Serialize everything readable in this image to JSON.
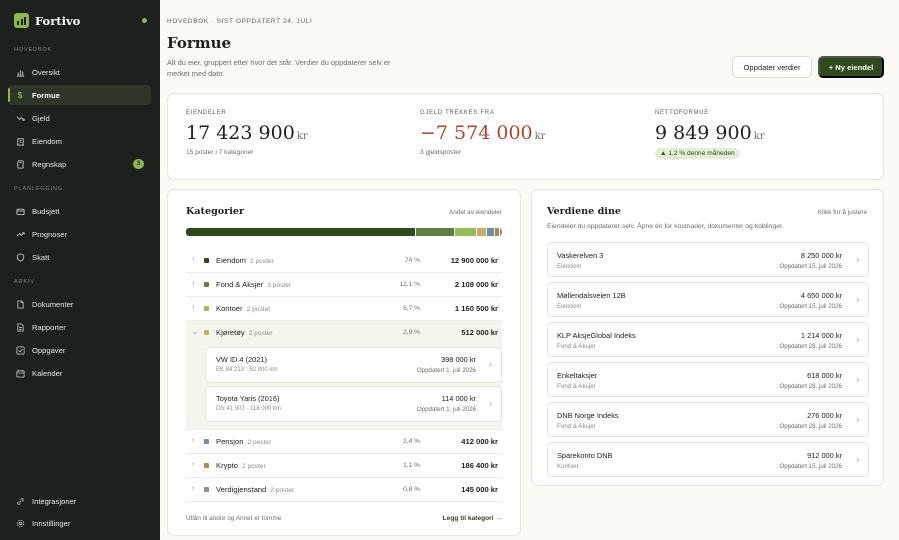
{
  "app": {
    "name": "Fortivo",
    "status_color": "#8ab94a",
    "accent": "#2f4a1b",
    "negative": "#b2432c"
  },
  "sidebar": {
    "sections": [
      {
        "label": "HOVEDBOK",
        "items": [
          {
            "label": "Oversikt",
            "icon": "bar-chart-icon"
          },
          {
            "label": "Formue",
            "icon": "dollar-icon",
            "active": true
          },
          {
            "label": "Gjeld",
            "icon": "trend-down-icon"
          },
          {
            "label": "Eiendom",
            "icon": "building-icon"
          },
          {
            "label": "Regnskap",
            "icon": "calculator-icon",
            "badge": "3"
          }
        ]
      },
      {
        "label": "PLANLEGGING",
        "items": [
          {
            "label": "Budsjett",
            "icon": "wallet-icon"
          },
          {
            "label": "Prognoser",
            "icon": "trend-up-icon"
          },
          {
            "label": "Skatt",
            "icon": "shield-icon"
          }
        ]
      },
      {
        "label": "ARKIV",
        "items": [
          {
            "label": "Dokumenter",
            "icon": "document-icon"
          },
          {
            "label": "Rapporter",
            "icon": "report-icon"
          },
          {
            "label": "Oppgaver",
            "icon": "checkbox-icon"
          },
          {
            "label": "Kalender",
            "icon": "calendar-icon"
          }
        ]
      }
    ],
    "footer": [
      {
        "label": "Integrasjoner",
        "icon": "link-icon"
      },
      {
        "label": "Innstillinger",
        "icon": "gear-icon"
      }
    ]
  },
  "header": {
    "eyebrow": "HOVEDBOK · SIST OPPDATERT 24. JULI",
    "title": "Formue",
    "subtitle": "Alt du eier, gruppert etter hvor det står. Verdier du oppdaterer selv er merket med dato.",
    "update_button": "Oppdater verdier",
    "new_button": "+ Ny eiendel"
  },
  "summary": {
    "assets": {
      "label": "EIENDELER",
      "value": "17 423 900",
      "unit": "kr",
      "note": "15 poster i 7 kategorier"
    },
    "debt": {
      "label": "GJELD TREKKES FRA",
      "value": "−7 574 000",
      "unit": "kr",
      "note": "3 gjeldsposter"
    },
    "net": {
      "label": "NETTOFORMUE",
      "value": "9 849 900",
      "unit": "kr",
      "change": "▲ 1,2 % denne måneden"
    }
  },
  "categories": {
    "title": "Kategorier",
    "aside": "Andel av eiendeler",
    "rows": [
      {
        "name": "Eiendom",
        "count": "2 poster",
        "pct": "74 %",
        "share": 74,
        "value": "12 900 000 kr",
        "color": "#2f4a1b",
        "chevron": "›"
      },
      {
        "name": "Fond & Aksjer",
        "count": "3 poster",
        "pct": "12,1 %",
        "share": 12.1,
        "value": "2 108 000 kr",
        "color": "#5e7f3e",
        "chevron": "›"
      },
      {
        "name": "Kontoer",
        "count": "2 poster",
        "pct": "6,7 %",
        "share": 6.7,
        "value": "1 160 500 kr",
        "color": "#8ec152",
        "chevron": "›"
      },
      {
        "name": "Kjøretøy",
        "count": "2 poster",
        "pct": "2,9 %",
        "share": 2.9,
        "value": "512 000 kr",
        "color": "#c9ad6a",
        "chevron": "⌄",
        "open": true,
        "items": [
          {
            "name": "VW ID.4 (2021)",
            "meta": "EK 84 213 · 62 000 km",
            "value": "398 000 kr",
            "updated": "Oppdatert 1. juli 2026"
          },
          {
            "name": "Toyota Yaris (2016)",
            "meta": "DN 41 902 · 118 000 km",
            "value": "114 000 kr",
            "updated": "Oppdatert 1. juli 2026"
          }
        ]
      },
      {
        "name": "Pensjon",
        "count": "2 poster",
        "pct": "2,4 %",
        "share": 2.4,
        "value": "412 000 kr",
        "color": "#6f8fa8",
        "chevron": "›"
      },
      {
        "name": "Krypto",
        "count": "2 poster",
        "pct": "1,1 %",
        "share": 1.1,
        "value": "186 400 kr",
        "color": "#b48a4a",
        "chevron": "›"
      },
      {
        "name": "Verdigjenstand",
        "count": "2 poster",
        "pct": "0,8 %",
        "share": 0.8,
        "value": "145 000 kr",
        "color": "#8f8f86",
        "chevron": "›"
      }
    ],
    "footer_note": "Utlån til andre og Annet er tomme",
    "add_link": "Legg til kategori →"
  },
  "values": {
    "title": "Verdiene dine",
    "aside": "Klikk for å justere",
    "subtitle": "Eiendeler du oppdaterer selv. Åpne én for kostnader, dokumenter og koblinger.",
    "items": [
      {
        "name": "Vaskerelven 3",
        "category": "Eiendom",
        "value": "8 250 000 kr",
        "updated": "Oppdatert 15. juli 2026"
      },
      {
        "name": "Møllendalsveien 12B",
        "category": "Eiendom",
        "value": "4 650 000 kr",
        "updated": "Oppdatert 15. juli 2026"
      },
      {
        "name": "KLP AksjeGlobal Indeks",
        "category": "Fond & Aksjer",
        "value": "1 214 000 kr",
        "updated": "Oppdatert 28. juli 2026"
      },
      {
        "name": "Enkeltaksjer",
        "category": "Fond & Aksjer",
        "value": "618 000 kr",
        "updated": "Oppdatert 28. juli 2026"
      },
      {
        "name": "DNB Norge Indeks",
        "category": "Fond & Aksjer",
        "value": "276 000 kr",
        "updated": "Oppdatert 28. juli 2026"
      },
      {
        "name": "Sparekonto DNB",
        "category": "Kontoer",
        "value": "912 000 kr",
        "updated": "Oppdatert 15. juli 2026"
      }
    ]
  }
}
